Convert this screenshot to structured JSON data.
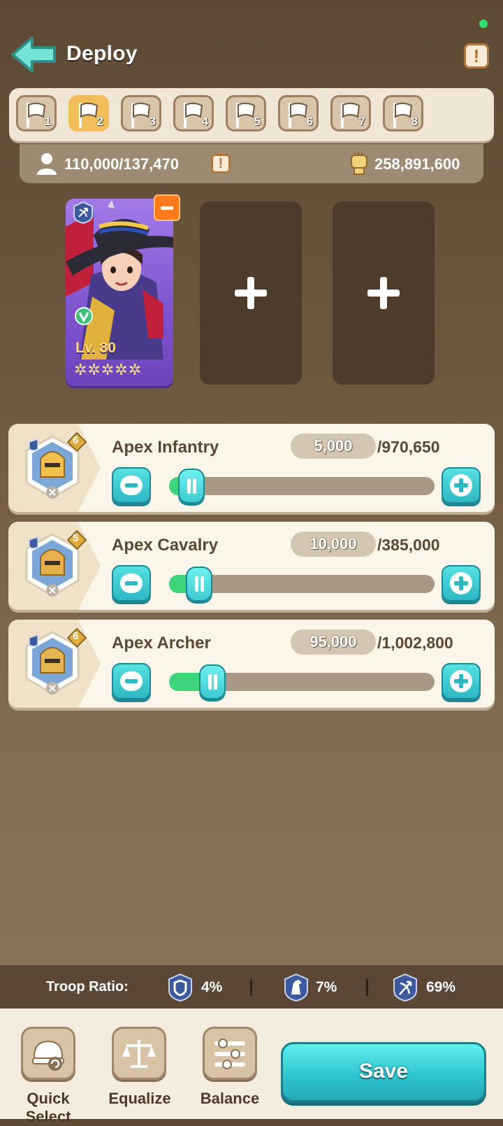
{
  "header": {
    "title": "Deploy",
    "alert_icon": "exclamation-icon"
  },
  "formation_tabs": [
    {
      "label": "1",
      "active": false
    },
    {
      "label": "2",
      "active": true
    },
    {
      "label": "3",
      "active": false
    },
    {
      "label": "4",
      "active": false
    },
    {
      "label": "5",
      "active": false
    },
    {
      "label": "6",
      "active": false
    },
    {
      "label": "7",
      "active": false
    },
    {
      "label": "8",
      "active": false
    }
  ],
  "stats": {
    "troop_capacity": "110,000/137,470",
    "power": "258,891,600"
  },
  "hero": {
    "level": "Lv. 80",
    "stars": 5
  },
  "troops": [
    {
      "name": "Apex Infantry",
      "count": "5,000",
      "max": "/970,650",
      "tier": "6",
      "fill": 0.005
    },
    {
      "name": "Apex Cavalry",
      "count": "10,000",
      "max": "/385,000",
      "tier": "5",
      "fill": 0.026
    },
    {
      "name": "Apex Archer",
      "count": "95,000",
      "max": "/1,002,800",
      "tier": "6",
      "fill": 0.095
    }
  ],
  "troop_ratio": {
    "label": "Troop Ratio:",
    "infantry": "4%",
    "cavalry": "7%",
    "archer": "69%"
  },
  "toolbar": {
    "quick_select": "Quick Select",
    "equalize": "Equalize",
    "balance": "Balance",
    "save": "Save"
  },
  "colors": {
    "accent": "#2fc6cf",
    "tab_active": "#f2be5a",
    "hero_card": "#8a5fd8",
    "status_dot": "#2ee06b"
  }
}
